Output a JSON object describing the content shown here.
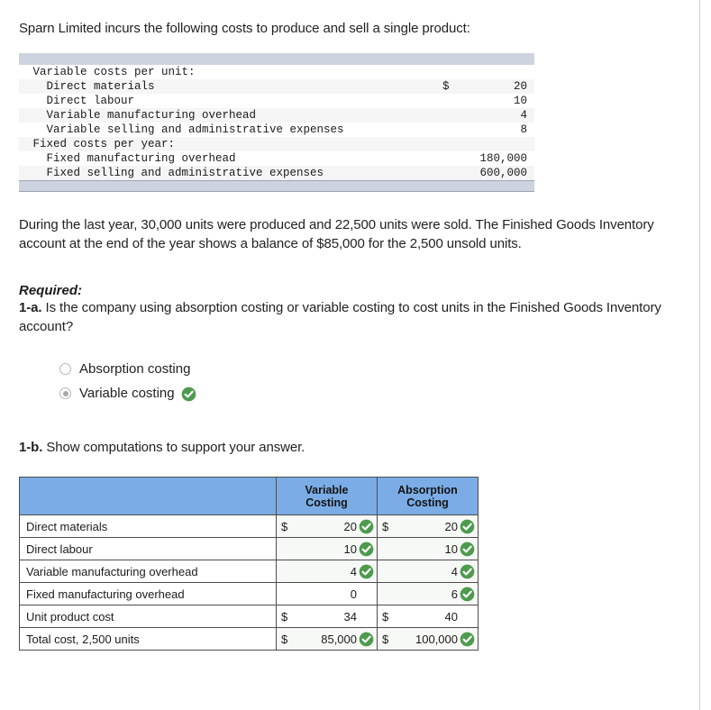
{
  "intro": "Sparn Limited incurs the following costs to produce and sell a single product:",
  "cost_table": {
    "rows": [
      {
        "label": "Variable costs per unit:",
        "indent": 0,
        "currency": "",
        "value": ""
      },
      {
        "label": "Direct materials",
        "indent": 1,
        "currency": "$",
        "value": "20"
      },
      {
        "label": "Direct labour",
        "indent": 1,
        "currency": "",
        "value": "10"
      },
      {
        "label": "Variable manufacturing overhead",
        "indent": 1,
        "currency": "",
        "value": "4"
      },
      {
        "label": "Variable selling and administrative expenses",
        "indent": 1,
        "currency": "",
        "value": "8"
      },
      {
        "label": "Fixed costs per year:",
        "indent": 0,
        "currency": "",
        "value": ""
      },
      {
        "label": "Fixed manufacturing overhead",
        "indent": 1,
        "currency": "",
        "value": "180,000"
      },
      {
        "label": "Fixed selling and administrative expenses",
        "indent": 1,
        "currency": "",
        "value": "600,000"
      }
    ]
  },
  "paragraph": "During the last year, 30,000 units were produced and 22,500 units were sold. The Finished Goods Inventory account at the end of the year shows a balance of $85,000 for the 2,500 unsold units.",
  "required_label": "Required:",
  "question_a": {
    "number": "1-a.",
    "text": " Is the company using absorption costing or variable costing to cost units in the Finished Goods Inventory account?",
    "options": [
      {
        "label": "Absorption costing",
        "selected": false,
        "correct": false
      },
      {
        "label": "Variable costing",
        "selected": true,
        "correct": true
      }
    ]
  },
  "question_b": {
    "number": "1-b.",
    "text": " Show computations to support your answer."
  },
  "answer_table": {
    "headers": [
      "",
      "Variable Costing",
      "Absorption Costing"
    ],
    "header_lines": [
      [
        "",
        ""
      ],
      [
        "Variable",
        "Costing"
      ],
      [
        "Absorption",
        "Costing"
      ]
    ],
    "rows": [
      {
        "label": "Direct materials",
        "variable": {
          "currency": "$",
          "value": "20",
          "correct": true
        },
        "absorption": {
          "currency": "$",
          "value": "20",
          "correct": true
        }
      },
      {
        "label": "Direct labour",
        "variable": {
          "currency": "",
          "value": "10",
          "correct": true
        },
        "absorption": {
          "currency": "",
          "value": "10",
          "correct": true
        }
      },
      {
        "label": "Variable manufacturing overhead",
        "variable": {
          "currency": "",
          "value": "4",
          "correct": true
        },
        "absorption": {
          "currency": "",
          "value": "4",
          "correct": true
        }
      },
      {
        "label": "Fixed manufacturing overhead",
        "variable": {
          "currency": "",
          "value": "0",
          "correct": false
        },
        "absorption": {
          "currency": "",
          "value": "6",
          "correct": true
        }
      },
      {
        "label": "Unit product cost",
        "variable": {
          "currency": "$",
          "value": "34",
          "correct": false
        },
        "absorption": {
          "currency": "$",
          "value": "40",
          "correct": false
        }
      },
      {
        "label": "Total cost, 2,500 units",
        "variable": {
          "currency": "$",
          "value": "85,000",
          "correct": true
        },
        "absorption": {
          "currency": "$",
          "value": "100,000",
          "correct": true
        }
      }
    ]
  },
  "colors": {
    "header_blue": "#7bace5",
    "check_green": "#4e9a4e",
    "cost_bar": "#ced3e0",
    "row_shade": "#f5f5f5",
    "filled_cell": "#f7f9f6"
  },
  "icons": {
    "check": "check-circle-icon"
  }
}
